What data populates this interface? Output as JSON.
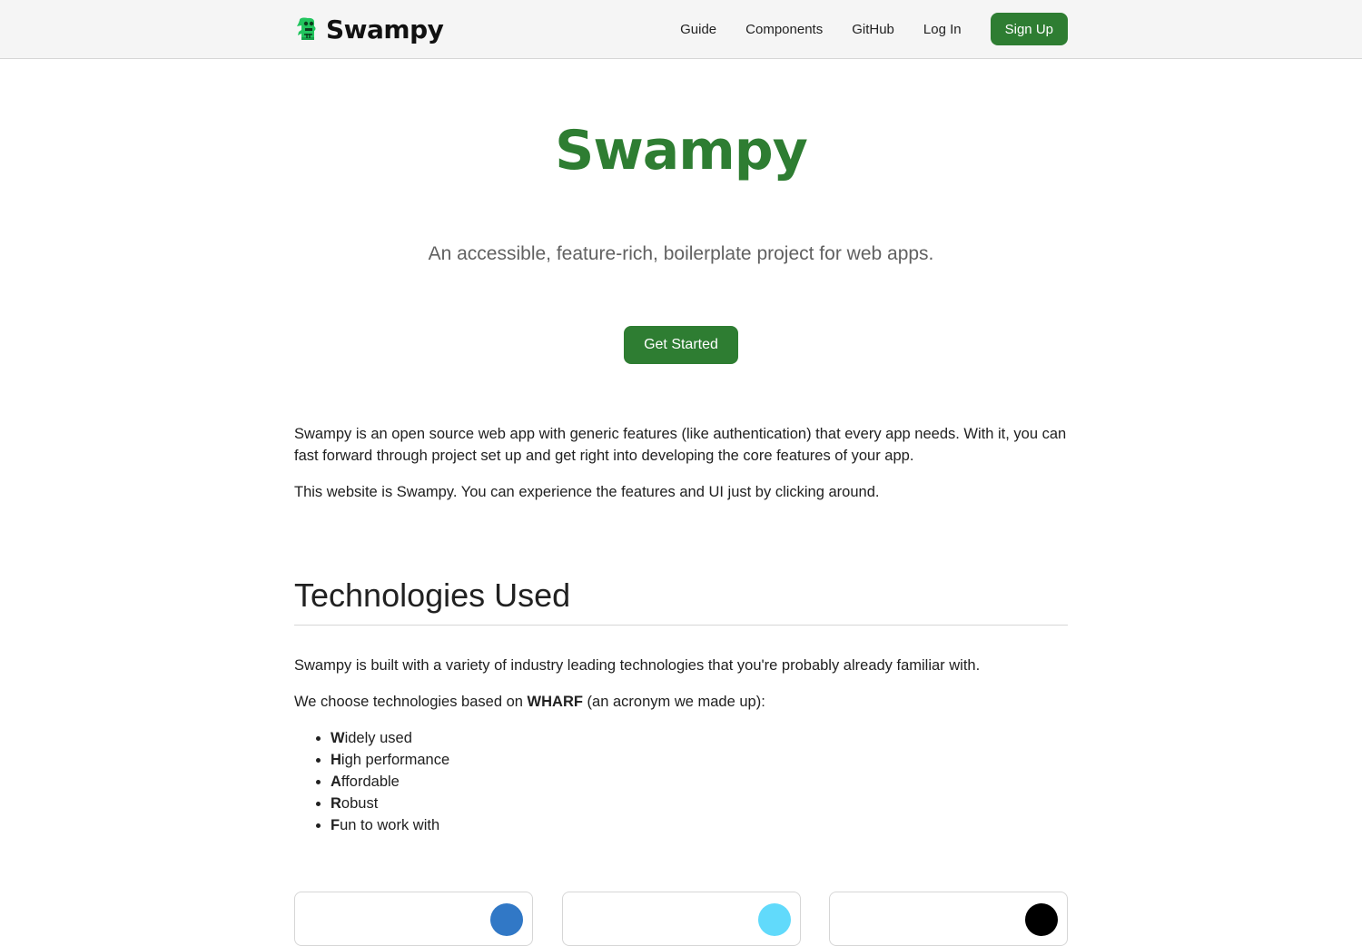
{
  "brand": {
    "name": "Swampy",
    "logo_icon": "swamp-monster-logo-icon",
    "logo_color": "#22c55e"
  },
  "nav": {
    "links": [
      "Guide",
      "Components",
      "GitHub",
      "Log In"
    ],
    "signup_label": "Sign Up"
  },
  "hero": {
    "title": "Swampy",
    "subtitle": "An accessible, feature-rich, boilerplate project for web apps.",
    "cta_label": "Get Started"
  },
  "intro": {
    "p1": "Swampy is an open source web app with generic features (like authentication) that every app needs. With it, you can fast forward through project set up and get right into developing the core features of your app.",
    "p2": "This website is Swampy. You can experience the features and UI just by clicking around."
  },
  "technologies": {
    "heading": "Technologies Used",
    "p1": "Swampy is built with a variety of industry leading technologies that you're probably already familiar with.",
    "p2_before": "We choose technologies based on ",
    "p2_bold": "WHARF",
    "p2_after": " (an acronym we made up):",
    "wharf": [
      {
        "letter": "W",
        "rest": "idely used"
      },
      {
        "letter": "H",
        "rest": "igh performance"
      },
      {
        "letter": "A",
        "rest": "ffordable"
      },
      {
        "letter": "R",
        "rest": "obust"
      },
      {
        "letter": "F",
        "rest": "un to work with"
      }
    ],
    "card_icon_colors": [
      "#3178c6",
      "#61dafb",
      "#000000"
    ]
  },
  "colors": {
    "primary_green": "#2e7d32",
    "navbar_bg": "#f5f5f5",
    "subtitle_gray": "#616161"
  }
}
